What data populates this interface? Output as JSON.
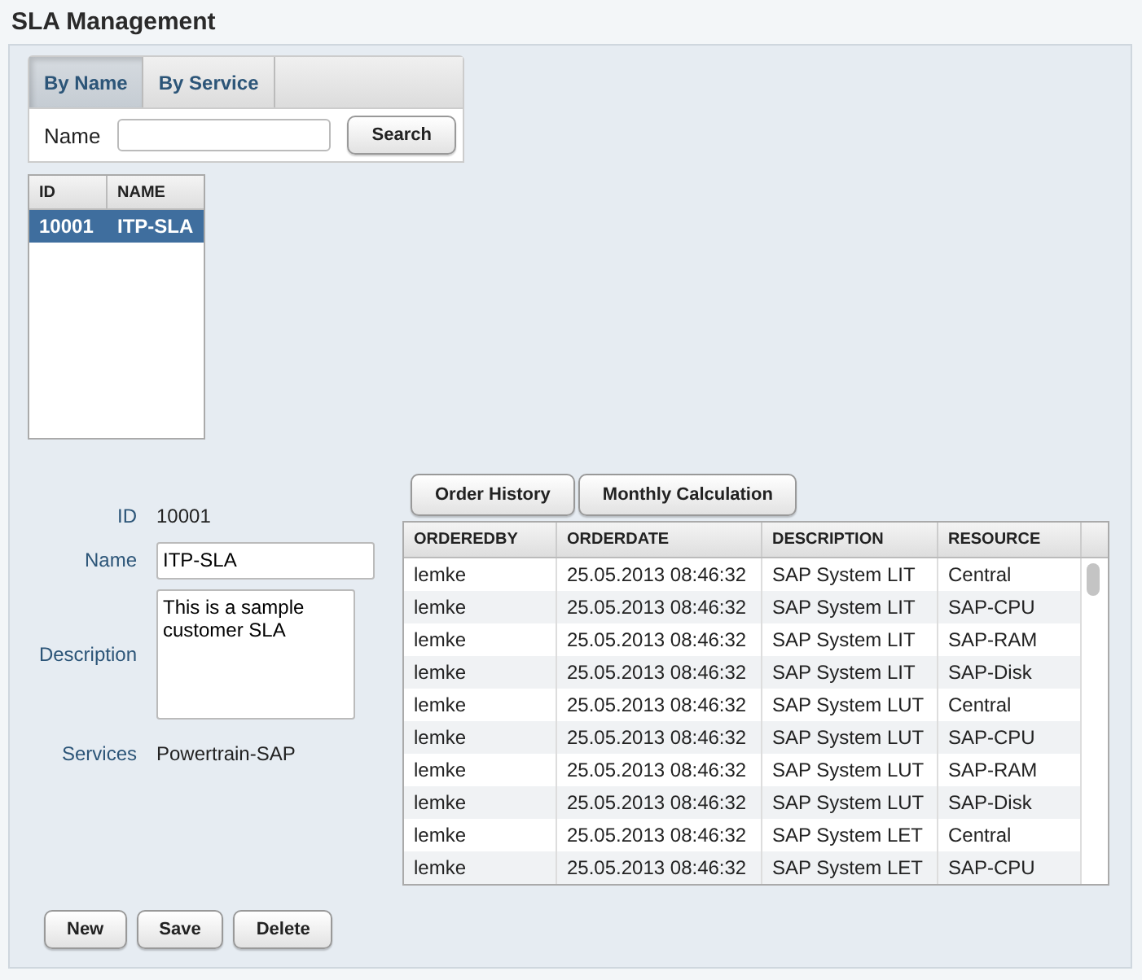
{
  "title": "SLA Management",
  "search_tabs": [
    {
      "label": "By Name",
      "selected": true
    },
    {
      "label": "By Service",
      "selected": false
    }
  ],
  "search": {
    "label": "Name",
    "button": "Search"
  },
  "sla_table": {
    "columns": [
      "ID",
      "NAME"
    ],
    "rows": [
      {
        "cells": [
          "10001",
          "ITP-SLA"
        ],
        "selected": true
      }
    ]
  },
  "form": {
    "id_label": "ID",
    "id_value": "10001",
    "name_label": "Name",
    "name_value": "ITP-SLA",
    "description_label": "Description",
    "description_value": "This is a sample customer SLA",
    "services_label": "Services",
    "services_value": "Powertrain-SAP"
  },
  "detail_buttons": [
    "Order History",
    "Monthly Calculation"
  ],
  "orders": {
    "columns": [
      "ORDEREDBY",
      "ORDERDATE",
      "DESCRIPTION",
      "RESOURCE"
    ],
    "rows": [
      [
        "lemke",
        "25.05.2013 08:46:32",
        "SAP System LIT",
        "Central"
      ],
      [
        "lemke",
        "25.05.2013 08:46:32",
        "SAP System LIT",
        "SAP-CPU"
      ],
      [
        "lemke",
        "25.05.2013 08:46:32",
        "SAP System LIT",
        "SAP-RAM"
      ],
      [
        "lemke",
        "25.05.2013 08:46:32",
        "SAP System LIT",
        "SAP-Disk"
      ],
      [
        "lemke",
        "25.05.2013 08:46:32",
        "SAP System LUT",
        "Central"
      ],
      [
        "lemke",
        "25.05.2013 08:46:32",
        "SAP System LUT",
        "SAP-CPU"
      ],
      [
        "lemke",
        "25.05.2013 08:46:32",
        "SAP System LUT",
        "SAP-RAM"
      ],
      [
        "lemke",
        "25.05.2013 08:46:32",
        "SAP System LUT",
        "SAP-Disk"
      ],
      [
        "lemke",
        "25.05.2013 08:46:32",
        "SAP System LET",
        "Central"
      ],
      [
        "lemke",
        "25.05.2013 08:46:32",
        "SAP System LET",
        "SAP-CPU"
      ]
    ]
  },
  "actions": [
    "New",
    "Save",
    "Delete"
  ]
}
